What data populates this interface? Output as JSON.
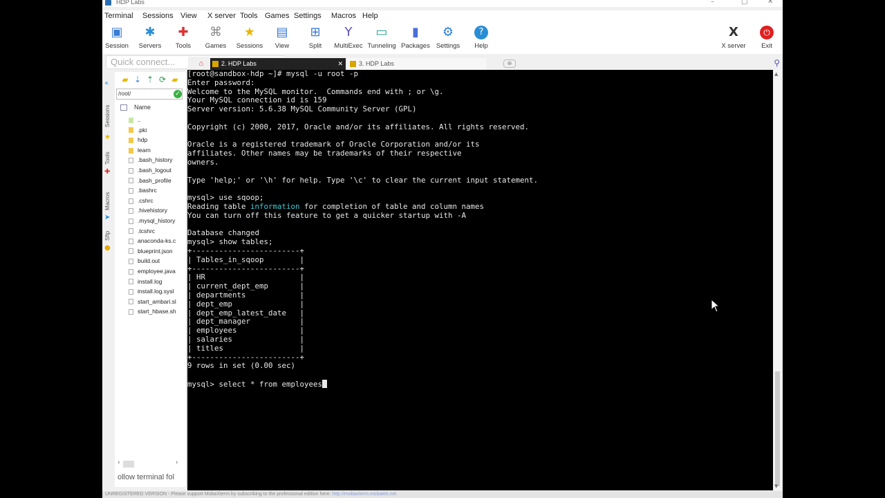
{
  "window": {
    "title": "HDP Labs"
  },
  "menu": [
    "Terminal",
    "Sessions",
    "View",
    "X server",
    "Tools",
    "Games",
    "Settings",
    "Macros",
    "Help"
  ],
  "toolbar": {
    "session": "Session",
    "servers": "Servers",
    "tools": "Tools",
    "games": "Games",
    "sessions": "Sessions",
    "view": "View",
    "split": "Split",
    "multiexec": "MultiExec",
    "tunneling": "Tunneling",
    "packages": "Packages",
    "settings": "Settings",
    "help": "Help",
    "xserver": "X server",
    "exit": "Exit"
  },
  "quick_connect": {
    "placeholder": "Quick connect..."
  },
  "left_rail": [
    "Sessions",
    "Tools",
    "Macros",
    "Sftp"
  ],
  "sftp": {
    "path": "/root/",
    "column_header": "Name",
    "files": [
      "..",
      ".pki",
      "hdp",
      "learn",
      ".bash_history",
      ".bash_logout",
      ".bash_profile",
      ".bashrc",
      ".cshrc",
      ".hivehistory",
      ".mysql_history",
      ".tcshrc",
      "anaconda-ks.c",
      "blueprint.json",
      "build.out",
      "employee.java",
      "install.log",
      "install.log.sysl",
      "start_ambari.sl",
      "start_hbase.sh"
    ],
    "follow_label": "ollow terminal fol"
  },
  "tabs": {
    "active": "2. HDP Labs",
    "inactive": "3. HDP Labs"
  },
  "terminal": {
    "lines": [
      "[root@sandbox-hdp ~]# mysql -u root -p",
      "Enter password:",
      "Welcome to the MySQL monitor.  Commands end with ; or \\g.",
      "Your MySQL connection id is 159",
      "Server version: 5.6.38 MySQL Community Server (GPL)",
      "",
      "Copyright (c) 2000, 2017, Oracle and/or its affiliates. All rights reserved.",
      "",
      "Oracle is a registered trademark of Oracle Corporation and/or its",
      "affiliates. Other names may be trademarks of their respective",
      "owners.",
      "",
      "Type 'help;' or '\\h' for help. Type '\\c' to clear the current input statement.",
      "",
      "mysql> use sqoop;",
      "Reading table information for completion of table and column names",
      "You can turn off this feature to get a quicker startup with -A",
      "",
      "Database changed",
      "mysql> show tables;",
      "+------------------------+",
      "| Tables_in_sqoop        |",
      "+------------------------+",
      "| HR                     |",
      "| current_dept_emp       |",
      "| departments            |",
      "| dept_emp               |",
      "| dept_emp_latest_date   |",
      "| dept_manager           |",
      "| employees              |",
      "| salaries               |",
      "| titles                 |",
      "+------------------------+",
      "9 rows in set (0.00 sec)",
      ""
    ],
    "highlight_word": "information",
    "highlight_line": 15,
    "prompt_line": "mysql> select * from employees"
  },
  "statusbar": {
    "text": "UNREGISTERED VERSION  -  Please support MobaXterm by subscribing to the professional edition here: ",
    "link": "http://mobaxterm.mobatek.net"
  },
  "colors": {
    "terminal_bg": "#000000",
    "terminal_fg": "#e8e8e8",
    "highlight": "#3fc9d6",
    "active_tab": "#222222"
  }
}
